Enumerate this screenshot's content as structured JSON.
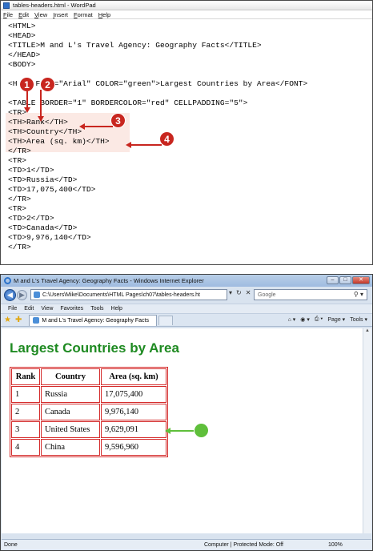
{
  "wordpad": {
    "title": "tables-headers.html - WordPad",
    "menu": [
      "File",
      "Edit",
      "View",
      "Insert",
      "Format",
      "Help"
    ],
    "lines": [
      "<HTML>",
      "<HEAD>",
      "<TITLE>M and L's Travel Agency: Geography Facts</TITLE>",
      "</HEAD>",
      "<BODY>",
      "",
      "<H    FACE=\"Arial\" COLOR=\"green\">Largest Countries by Area</FONT>",
      "",
      "<TABLE BORDER=\"1\" BORDERCOLOR=\"red\" CELLPADDING=\"5\">",
      "<TR>",
      "<TH>Rank</TH>",
      "<TH>Country</TH>",
      "<TH>Area (sq. km)</TH>",
      "</TR>",
      "<TR>",
      "<TD>1</TD>",
      "<TD>Russia</TD>",
      "<TD>17,075,400</TD>",
      "</TR>",
      "<TR>",
      "<TD>2</TD>",
      "<TD>Canada</TD>",
      "<TD>9,976,140</TD>",
      "</TR>"
    ],
    "callouts": [
      "1",
      "2",
      "3",
      "4"
    ]
  },
  "ie": {
    "title": "M and L's Travel Agency: Geography Facts - Windows Internet Explorer",
    "address": "C:\\Users\\Mike\\Documents\\HTML Pages\\ch07\\tables-headers.ht",
    "search_placeholder": "Google",
    "menu": [
      "File",
      "Edit",
      "View",
      "Favorites",
      "Tools",
      "Help"
    ],
    "tab_label": "M and L's Travel Agency: Geography Facts",
    "commands": [
      "Page ▾",
      "Tools ▾"
    ],
    "status_left": "Done",
    "status_zone": "Computer | Protected Mode: Off",
    "status_zoom": "100%",
    "page": {
      "heading": "Largest Countries by Area",
      "table": {
        "headers": [
          "Rank",
          "Country",
          "Area (sq. km)"
        ],
        "rows": [
          [
            "1",
            "Russia",
            "17,075,400"
          ],
          [
            "2",
            "Canada",
            "9,976,140"
          ],
          [
            "3",
            "United States",
            "9,629,091"
          ],
          [
            "4",
            "China",
            "9,596,960"
          ]
        ]
      }
    }
  },
  "colors": {
    "heading_green": "#1e8a21",
    "table_border_red": "#d42a2a",
    "callout_red": "#c8261f",
    "callout_green": "#5fbf3b"
  }
}
